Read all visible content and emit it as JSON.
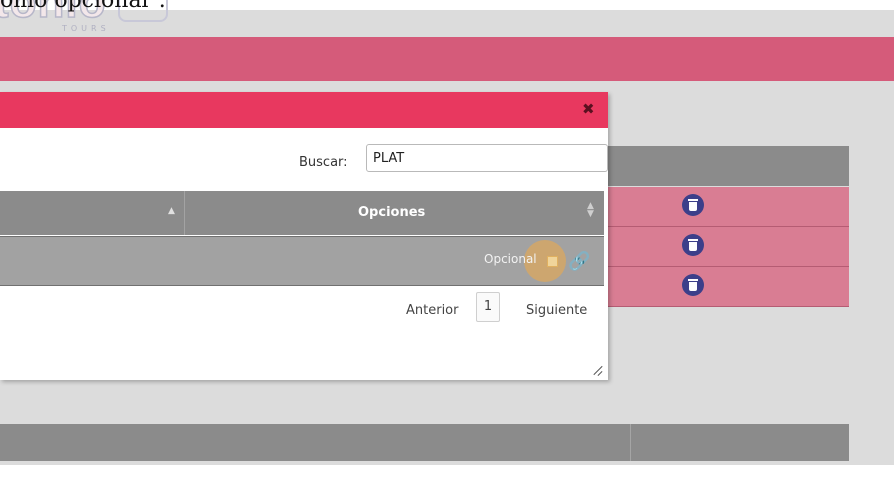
{
  "caption": "omo opcional\".",
  "logo": {
    "word": "tonio",
    "tag": "TOURS"
  },
  "modal": {
    "close_label": "✖",
    "search_label": "Buscar:",
    "search_value": "PLAT",
    "table": {
      "column_options": "Opciones",
      "sort_asc_glyph": "▲",
      "sort_both_glyph": "▲▼",
      "rows": [
        {
          "option_label": "Opcional",
          "link_icon": "🔗"
        }
      ]
    },
    "pagination": {
      "prev": "Anterior",
      "page": "1",
      "next": "Siguiente"
    }
  },
  "background": {
    "header_color": "#d55b7a",
    "modal_header_color": "#e8385f",
    "row_color": "#d97d93",
    "trash_icon_color": "#3c3f8a",
    "rows_count_icons": [
      "trash-icon",
      "trash-icon",
      "trash-icon"
    ]
  }
}
